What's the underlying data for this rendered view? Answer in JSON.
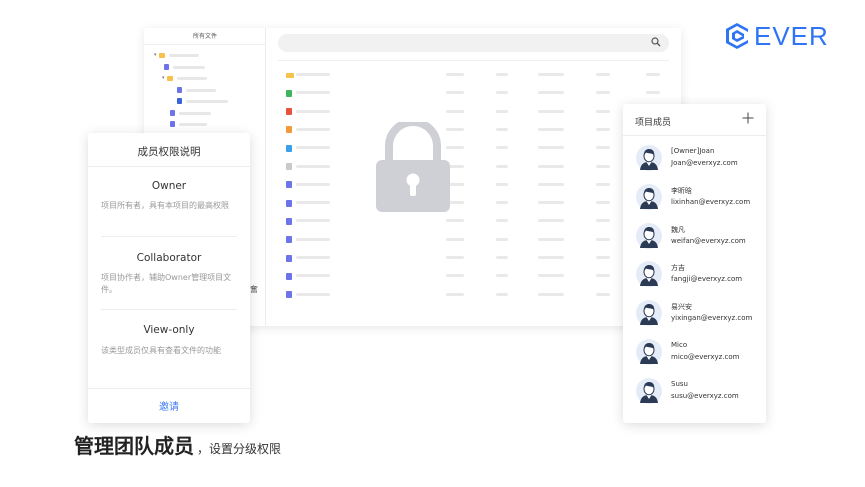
{
  "logo": {
    "text": "EVER",
    "color": "#2f74f5"
  },
  "file_manager": {
    "sidebar_title": "所有文件",
    "search_icon": "search-icon",
    "file_icon_colors": [
      "#f6c24a",
      "#3fb45a",
      "#e5533d",
      "#f29a3a",
      "#3aa0e8",
      "#c9c9c9",
      "#6d73e8",
      "#6d73e8",
      "#6d73e8",
      "#6d73e8",
      "#6d73e8",
      "#6d73e8",
      "#6d73e8"
    ]
  },
  "lock_icon": "lock-icon",
  "permissions": {
    "title": "成员权限说明",
    "roles": [
      {
        "name": "Owner",
        "description": "项目所有者，具有本项目的最高权限"
      },
      {
        "name": "Collaborator",
        "description": "项目协作者，辅助Owner管理项目文件。"
      },
      {
        "name": "View-only",
        "description": "该类型成员仅具有查看文件的功能"
      }
    ],
    "invite_label": "邀请",
    "edge_char": "奮"
  },
  "members": {
    "title": "项目成员",
    "add_icon": "plus-icon",
    "list": [
      {
        "name": "[Owner]Joan",
        "email": "Joan@everxyz.com"
      },
      {
        "name": "李昕晗",
        "email": "lixinhan@everxyz.com"
      },
      {
        "name": "魏凡",
        "email": "weifan@everxyz.com"
      },
      {
        "name": "方吉",
        "email": "fangji@everxyz.com"
      },
      {
        "name": "易兴安",
        "email": "yixingan@everxyz.com"
      },
      {
        "name": "Mico",
        "email": "mico@everxyz.com"
      },
      {
        "name": "Susu",
        "email": "susu@everxyz.com"
      }
    ]
  },
  "caption": {
    "main": "管理团队成员",
    "sub": "，设置分级权限"
  }
}
